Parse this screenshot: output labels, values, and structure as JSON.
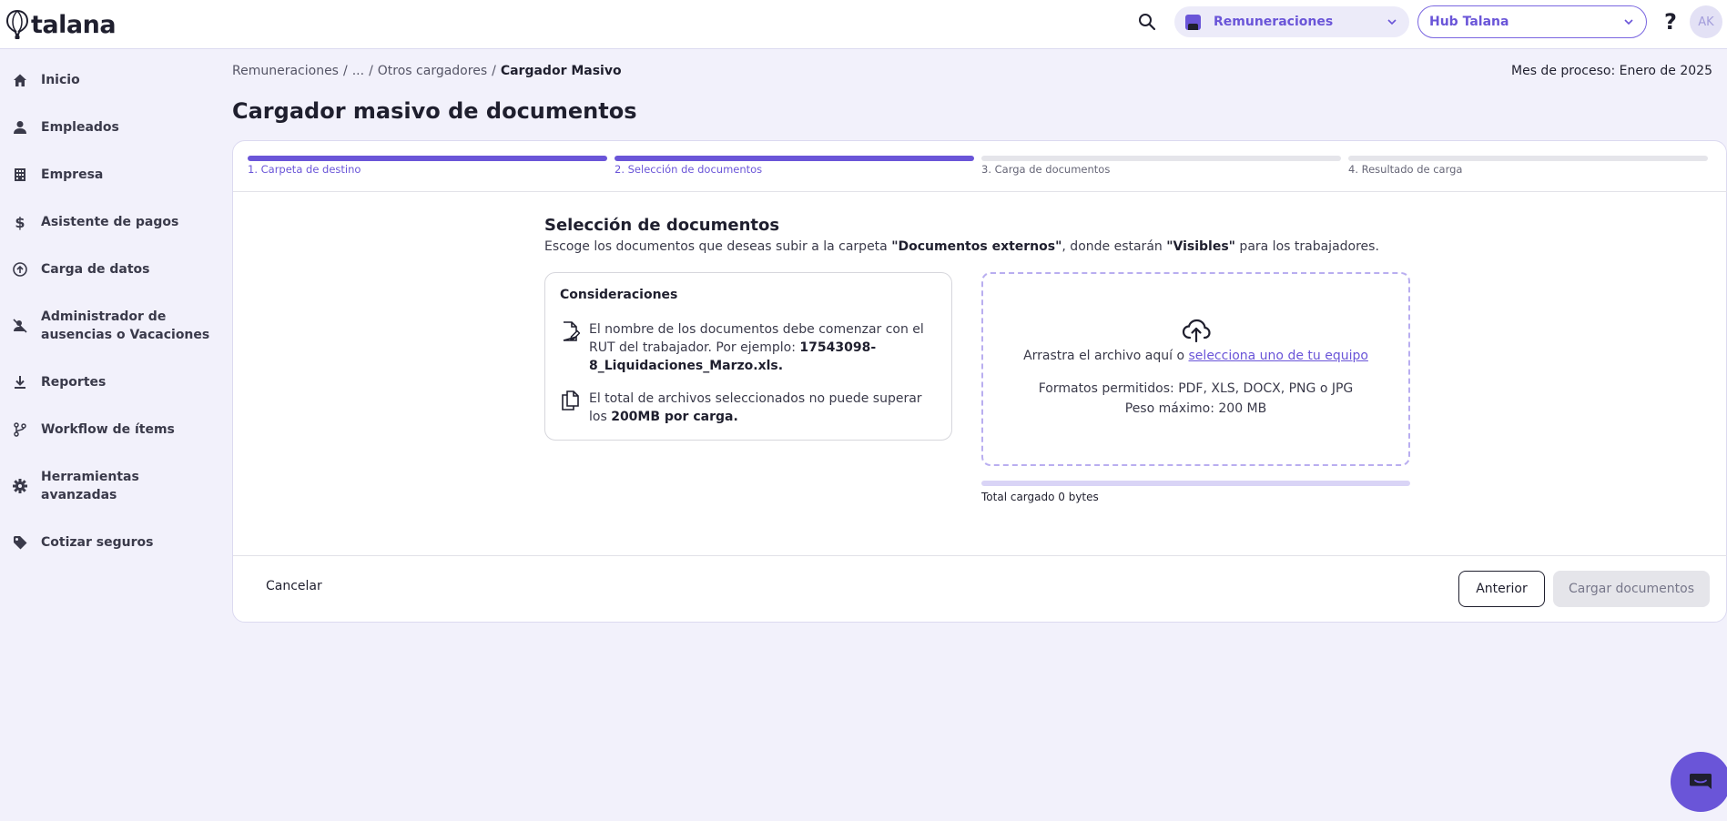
{
  "app": {
    "logo_text": "talana"
  },
  "header": {
    "module": "Remuneraciones",
    "hub": "Hub Talana",
    "help": "?",
    "avatar_initials": "AK"
  },
  "sidebar": {
    "items": [
      {
        "label": "Inicio",
        "icon": "home-icon"
      },
      {
        "label": "Empleados",
        "icon": "person-icon"
      },
      {
        "label": "Empresa",
        "icon": "building-icon"
      },
      {
        "label": "Asistente de pagos",
        "icon": "dollar-icon"
      },
      {
        "label": "Carga de datos",
        "icon": "upload-circle-icon"
      },
      {
        "label": "Administrador de ausencias o Vacaciones",
        "icon": "person-off-icon"
      },
      {
        "label": "Reportes",
        "icon": "download-icon"
      },
      {
        "label": "Workflow de ítems",
        "icon": "branch-icon"
      },
      {
        "label": "Herramientas avanzadas",
        "icon": "gear-icon"
      },
      {
        "label": "Cotizar seguros",
        "icon": "tag-icon"
      }
    ]
  },
  "breadcrumb": {
    "items": [
      "Remuneraciones",
      "...",
      "Otros cargadores"
    ],
    "separator": "/",
    "current": "Cargador Masivo"
  },
  "process_month": "Mes de proceso: Enero de 2025",
  "page_title": "Cargador masivo de documentos",
  "stepper": {
    "steps": [
      {
        "label": "1. Carpeta de destino",
        "active": true
      },
      {
        "label": "2. Selección de documentos",
        "active": true
      },
      {
        "label": "3. Carga de documentos",
        "active": false
      },
      {
        "label": "4. Resultado de carga",
        "active": false
      }
    ]
  },
  "selection": {
    "title": "Selección de documentos",
    "desc_prefix": "Escoge los documentos que deseas subir a la carpeta ",
    "folder": "\"Documentos externos\"",
    "desc_middle": ", donde estarán ",
    "visibility": "\"Visibles\"",
    "desc_suffix": " para los trabajadores."
  },
  "considerations": {
    "title": "Consideraciones",
    "item1_text": "El nombre de los documentos debe comenzar con el RUT del trabajador. Por ejemplo: ",
    "item1_bold": "17543098-8_Liquidaciones_Marzo.xls.",
    "item2_text": "El total de archivos seleccionados no puede superar los ",
    "item2_bold": "200MB por carga."
  },
  "dropzone": {
    "drop_text": "Arrastra el archivo aquí o ",
    "link_text": "selecciona uno de tu equipo",
    "formats": "Formatos permitidos: PDF, XLS, DOCX, PNG o JPG",
    "max_weight": "Peso máximo: 200 MB"
  },
  "upload_progress": {
    "fraction": 0,
    "label": "Total cargado 0 bytes"
  },
  "footer": {
    "cancel": "Cancelar",
    "previous": "Anterior",
    "submit": "Cargar documentos"
  },
  "colors": {
    "accent": "#6a55d8",
    "background": "#f2f1fb"
  }
}
